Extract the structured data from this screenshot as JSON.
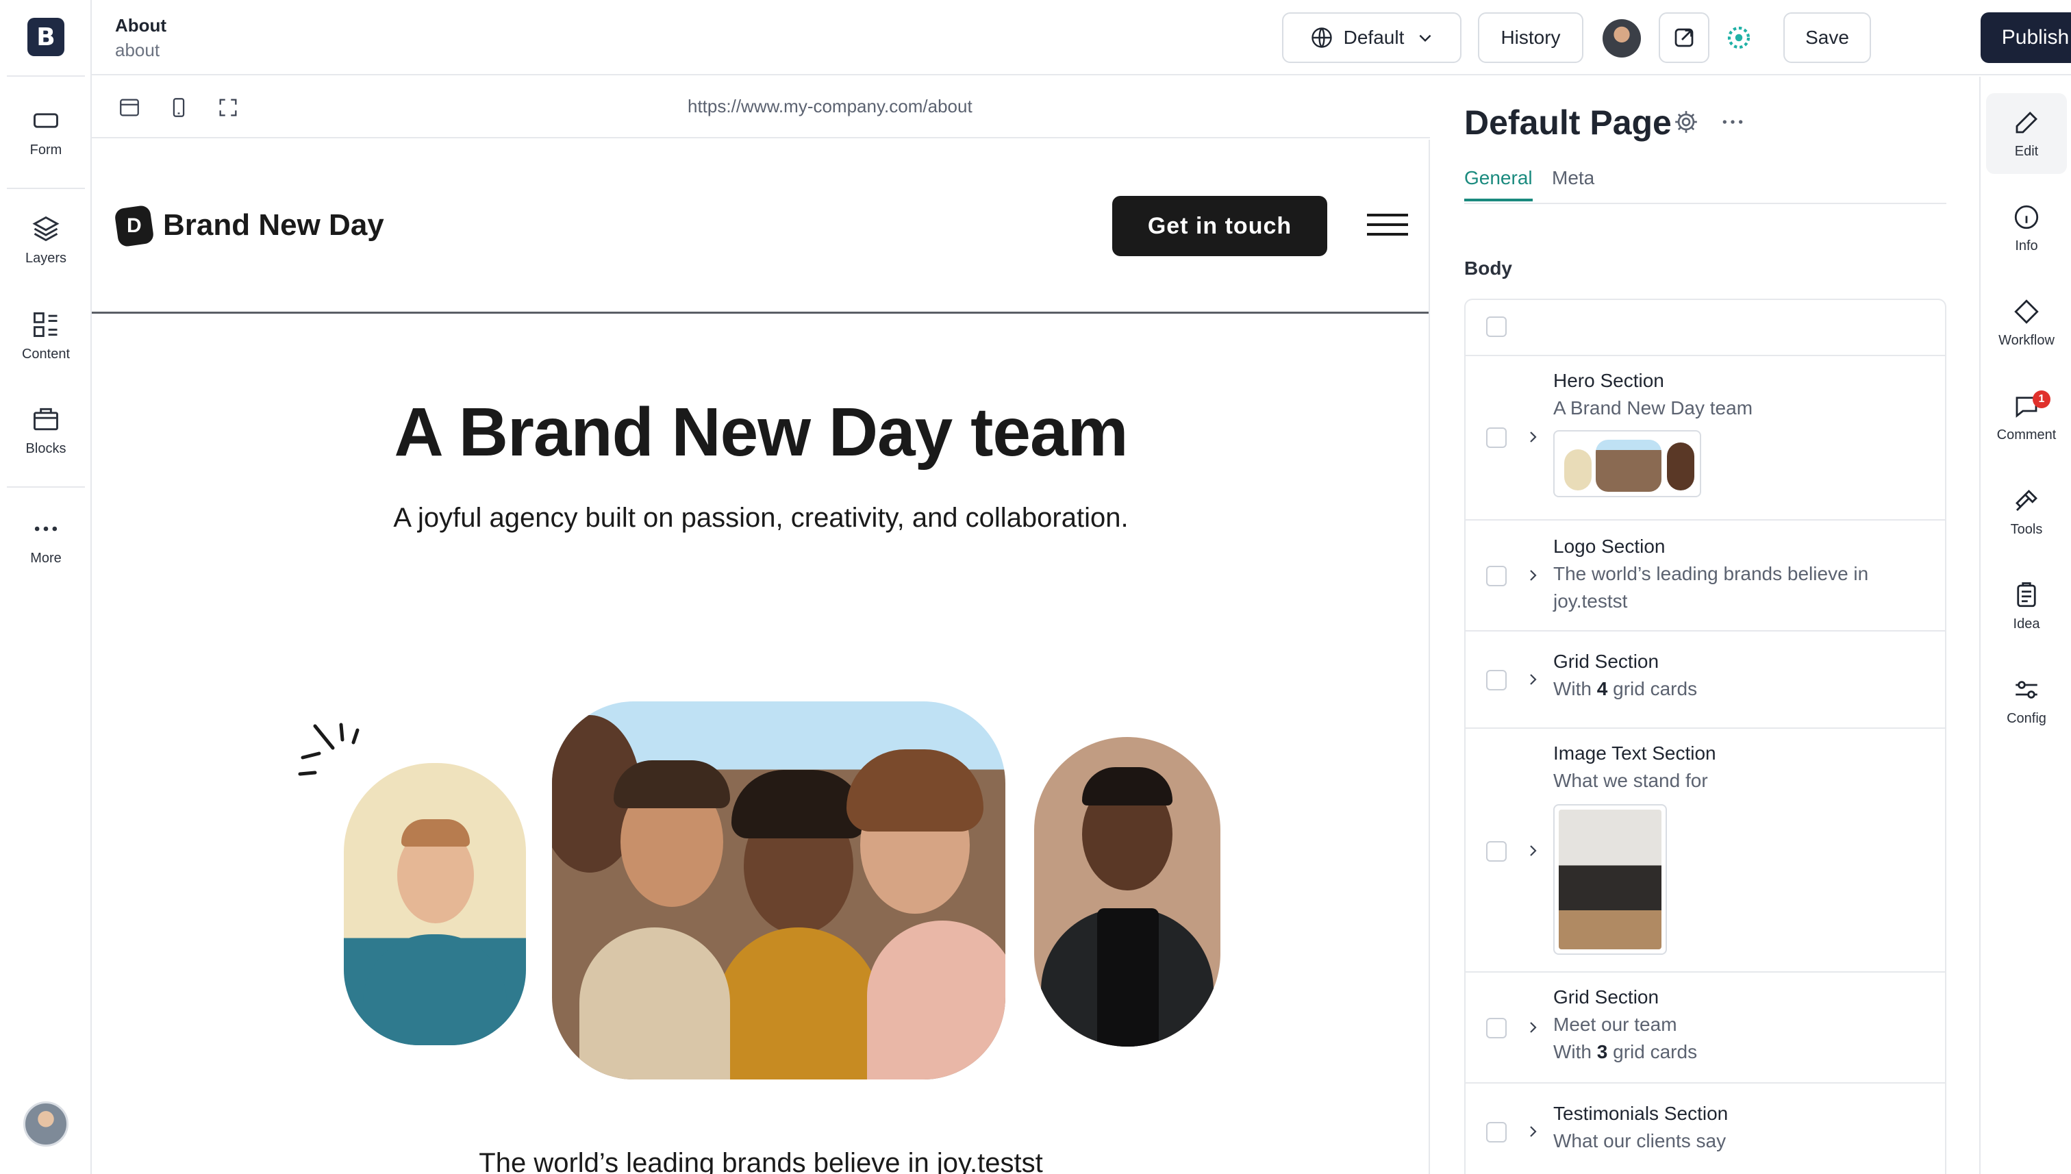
{
  "app": {
    "logo_letter": "B"
  },
  "left_rail": {
    "items": [
      {
        "label": "Form",
        "icon": "form-icon"
      },
      {
        "label": "Layers",
        "icon": "layers-icon"
      },
      {
        "label": "Content",
        "icon": "content-icon"
      },
      {
        "label": "Blocks",
        "icon": "blocks-icon"
      },
      {
        "label": "More",
        "icon": "more-dots-icon"
      }
    ]
  },
  "topbar": {
    "page_title": "About",
    "page_slug": "about",
    "locale_label": "Default",
    "history_label": "History",
    "save_label": "Save",
    "publish_label": "Publish"
  },
  "preview": {
    "url": "https://www.my-company.com/about",
    "brand_mark_letter": "D",
    "brand_name": "Brand New Day",
    "cta_label": "Get in touch",
    "hero_title": "A Brand New Day team",
    "hero_subtitle": "A joyful agency built on passion, creativity, and collaboration.",
    "logo_line": "The world’s leading brands believe in joy.testst"
  },
  "panel": {
    "title": "Default Page",
    "tabs": [
      "General",
      "Meta"
    ],
    "active_tab": "General",
    "body_label": "Body",
    "blocks": [
      {
        "title": "Hero Section",
        "subtitle": "A Brand New Day team"
      },
      {
        "title": "Logo Section",
        "subtitle": "The world’s leading brands believe in joy.testst"
      },
      {
        "title": "Grid Section",
        "subtitle_prefix": "With",
        "count": "4",
        "subtitle_suffix": "grid cards"
      },
      {
        "title": "Image Text Section",
        "subtitle": "What we stand for"
      },
      {
        "title": "Grid Section",
        "subtitle": "Meet our team",
        "subtitle2_prefix": "With",
        "count": "3",
        "subtitle2_suffix": "grid cards"
      },
      {
        "title": "Testimonials Section",
        "subtitle": "What our clients say"
      }
    ]
  },
  "right_rail": {
    "items": [
      {
        "label": "Edit",
        "icon": "pencil-icon"
      },
      {
        "label": "Info",
        "icon": "info-icon"
      },
      {
        "label": "Workflow",
        "icon": "workflow-diamond-icon"
      },
      {
        "label": "Comment",
        "icon": "comment-icon",
        "badge": "1"
      },
      {
        "label": "Tools",
        "icon": "hammer-icon"
      },
      {
        "label": "Idea",
        "icon": "clipboard-icon"
      },
      {
        "label": "Config",
        "icon": "sliders-icon"
      }
    ]
  },
  "colors": {
    "accent": "#1a8a7e",
    "primary_button": "#1a2238",
    "badge": "#e0312c"
  }
}
